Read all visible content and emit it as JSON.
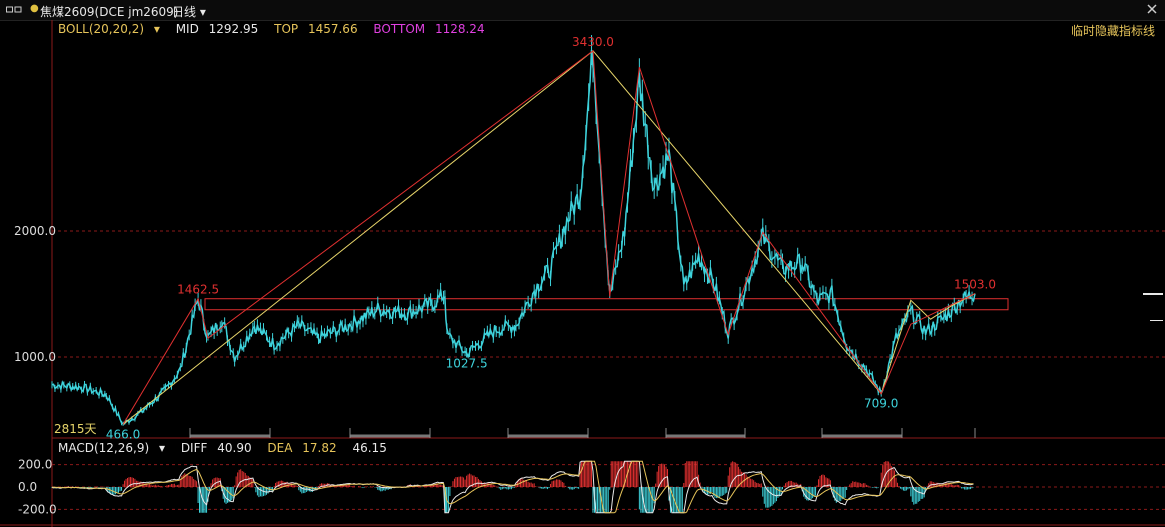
{
  "header": {
    "title": "焦煤2609(DCE jm2609)",
    "period": "日线",
    "hide_lines_label": "临时隐藏指标线"
  },
  "indicators": {
    "boll": {
      "name": "BOLL(20,20,2)",
      "mid_label": "MID",
      "mid_value": "1292.95",
      "top_label": "TOP",
      "top_value": "1457.66",
      "bottom_label": "BOTTOM",
      "bottom_value": "1128.24"
    },
    "macd": {
      "name": "MACD(12,26,9)",
      "diff_label": "DIFF",
      "diff_value": "40.90",
      "dea_label": "DEA",
      "dea_value": "17.82",
      "macd_value": "46.15"
    }
  },
  "colors": {
    "boll_name": "#e6c45a",
    "mid": "#e8e8e8",
    "top": "#e6c45a",
    "bottom": "#e040e0",
    "candle": "#3ed3dc",
    "wave_red": "#e03030",
    "wave_yellow": "#e6d46a",
    "macd_pos": "#e03030",
    "macd_neg": "#3ed3dc",
    "diff": "#e8e8e8",
    "dea": "#e6c45a"
  },
  "chart_data": [
    {
      "type": "line",
      "title": "",
      "y_ticks": [
        "2000.0",
        "1000.0"
      ],
      "days_label": "2815天",
      "annotations": [
        {
          "text": "3430.0",
          "value": 3430.0,
          "kind": "high"
        },
        {
          "text": "1462.5",
          "value": 1462.5,
          "kind": "high"
        },
        {
          "text": "1503.0",
          "value": 1503.0,
          "kind": "high"
        },
        {
          "text": "466.0",
          "value": 466.0,
          "kind": "low"
        },
        {
          "text": "1027.5",
          "value": 1027.5,
          "kind": "low"
        },
        {
          "text": "709.0",
          "value": 709.0,
          "kind": "low"
        }
      ],
      "price_points": [
        {
          "i": 0,
          "v": 780
        },
        {
          "i": 30,
          "v": 760
        },
        {
          "i": 55,
          "v": 700
        },
        {
          "i": 72,
          "v": 466
        },
        {
          "i": 90,
          "v": 560
        },
        {
          "i": 115,
          "v": 740
        },
        {
          "i": 130,
          "v": 900
        },
        {
          "i": 148,
          "v": 1462.5
        },
        {
          "i": 158,
          "v": 1150
        },
        {
          "i": 172,
          "v": 1300
        },
        {
          "i": 185,
          "v": 1000
        },
        {
          "i": 205,
          "v": 1250
        },
        {
          "i": 225,
          "v": 1100
        },
        {
          "i": 250,
          "v": 1250
        },
        {
          "i": 270,
          "v": 1150
        },
        {
          "i": 300,
          "v": 1250
        },
        {
          "i": 330,
          "v": 1380
        },
        {
          "i": 360,
          "v": 1350
        },
        {
          "i": 385,
          "v": 1420
        },
        {
          "i": 398,
          "v": 1500
        },
        {
          "i": 400,
          "v": 1180
        },
        {
          "i": 420,
          "v": 1027.5
        },
        {
          "i": 450,
          "v": 1220
        },
        {
          "i": 470,
          "v": 1250
        },
        {
          "i": 490,
          "v": 1550
        },
        {
          "i": 505,
          "v": 1700
        },
        {
          "i": 520,
          "v": 2050
        },
        {
          "i": 535,
          "v": 2300
        },
        {
          "i": 548,
          "v": 3430.0
        },
        {
          "i": 565,
          "v": 1480
        },
        {
          "i": 580,
          "v": 2000
        },
        {
          "i": 595,
          "v": 3200
        },
        {
          "i": 610,
          "v": 2350
        },
        {
          "i": 625,
          "v": 2600
        },
        {
          "i": 640,
          "v": 1550
        },
        {
          "i": 655,
          "v": 1800
        },
        {
          "i": 670,
          "v": 1600
        },
        {
          "i": 685,
          "v": 1200
        },
        {
          "i": 700,
          "v": 1500
        },
        {
          "i": 720,
          "v": 1950
        },
        {
          "i": 740,
          "v": 1700
        },
        {
          "i": 760,
          "v": 1750
        },
        {
          "i": 775,
          "v": 1450
        },
        {
          "i": 790,
          "v": 1500
        },
        {
          "i": 805,
          "v": 1100
        },
        {
          "i": 825,
          "v": 900
        },
        {
          "i": 840,
          "v": 709.0
        },
        {
          "i": 855,
          "v": 1150
        },
        {
          "i": 870,
          "v": 1360
        },
        {
          "i": 885,
          "v": 1200
        },
        {
          "i": 905,
          "v": 1320
        },
        {
          "i": 920,
          "v": 1450
        },
        {
          "i": 935,
          "v": 1503.0
        }
      ],
      "zigzag_red": [
        {
          "i": 72,
          "v": 466
        },
        {
          "i": 148,
          "v": 1462.5
        },
        {
          "i": 158,
          "v": 1150
        },
        {
          "i": 548,
          "v": 3430
        },
        {
          "i": 565,
          "v": 1480
        },
        {
          "i": 595,
          "v": 3300
        },
        {
          "i": 685,
          "v": 1180
        },
        {
          "i": 720,
          "v": 1990
        },
        {
          "i": 840,
          "v": 709
        },
        {
          "i": 870,
          "v": 1260
        },
        {
          "i": 935,
          "v": 1503
        }
      ],
      "zigzag_yellow": [
        {
          "i": 72,
          "v": 466
        },
        {
          "i": 548,
          "v": 3430
        },
        {
          "i": 840,
          "v": 709
        },
        {
          "i": 870,
          "v": 1450
        },
        {
          "i": 890,
          "v": 1300
        },
        {
          "i": 910,
          "v": 1400
        },
        {
          "i": 935,
          "v": 1503
        }
      ],
      "resistance_band": [
        1375,
        1462.5
      ]
    },
    {
      "type": "bar",
      "y_ticks": [
        "200.0",
        "0.0",
        "-200.0"
      ]
    }
  ]
}
